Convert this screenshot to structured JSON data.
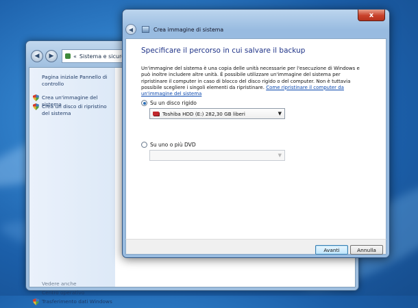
{
  "control_panel": {
    "address_separator": "«",
    "address": "Sistema e sicurezza",
    "sidebar": {
      "items": [
        {
          "label": "Pagina iniziale Pannello di controllo",
          "icon": ""
        },
        {
          "label": "Crea un'immagine del sistema",
          "icon": "shield-icon"
        },
        {
          "label": "Crea un disco di ripristino del sistema",
          "icon": "shield-icon"
        }
      ],
      "see_also_label": "Vedere anche",
      "see_also": [
        {
          "label": "Centro operativo",
          "icon": ""
        },
        {
          "label": "Trasferimento dati Windows",
          "icon": "shield-icon"
        }
      ]
    }
  },
  "dialog": {
    "title": "Crea immagine di sistema",
    "close_glyph": "x",
    "heading": "Specificare il percorso in cui salvare il backup",
    "description": "Un'immagine del sistema è una copia delle unità necessarie per l'esecuzione di Windows e può inoltre includere altre unità. È possibile utilizzare un'immagine del sistema per ripristinare il computer in caso di blocco del disco rigido o del computer. Non è tuttavia possibile scegliere i singoli elementi da ripristinare.",
    "help_link": "Come ripristinare il computer da un'immagine del sistema",
    "options": [
      {
        "label": "Su un disco rigido",
        "selected": true,
        "combo_value": "Toshiba HDD (E:)  282,30 GB liberi",
        "combo_enabled": true
      },
      {
        "label": "Su uno o più DVD",
        "selected": false,
        "combo_value": "",
        "combo_enabled": false
      }
    ],
    "buttons": {
      "next": "Avanti",
      "cancel": "Annulla"
    }
  },
  "colors": {
    "heading": "#1e3287",
    "link": "#0645ad",
    "close_button": "#c8412a",
    "desktop": "#1b5ea8"
  }
}
